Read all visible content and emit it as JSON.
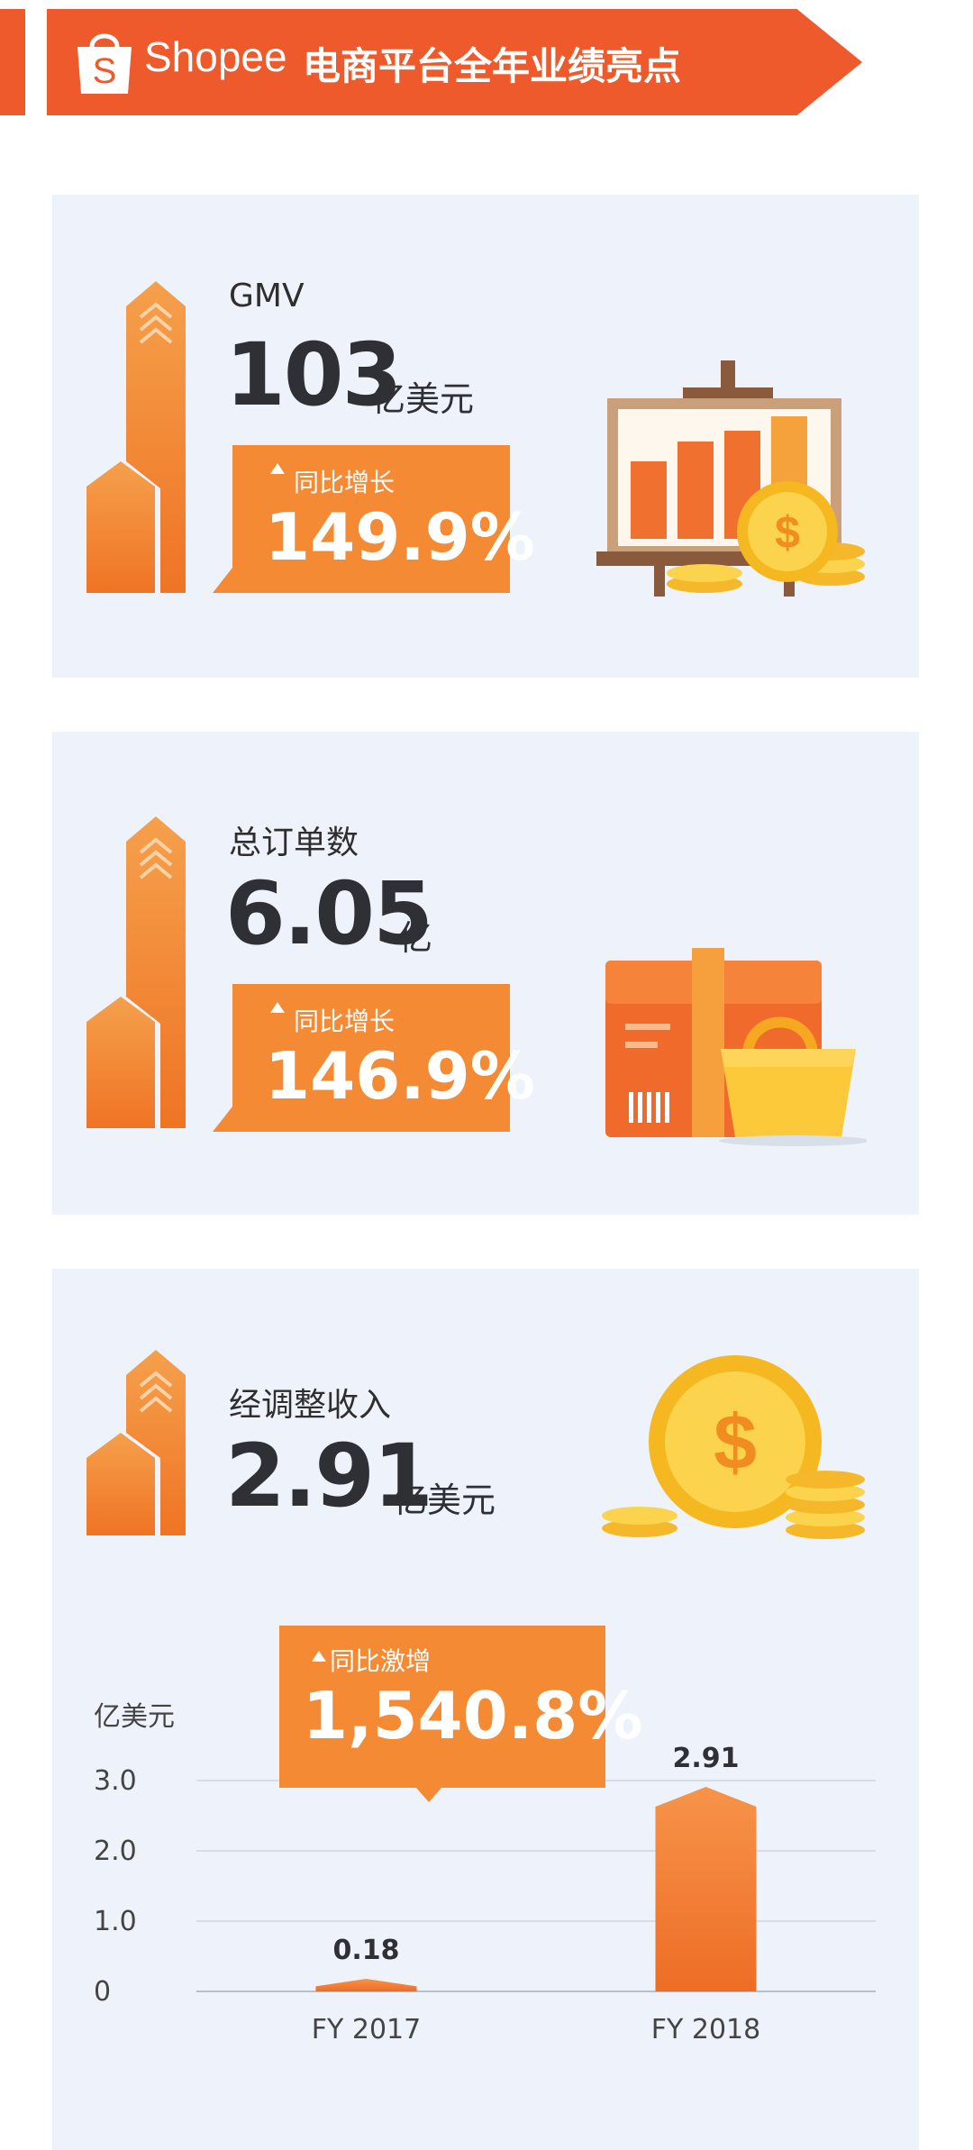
{
  "header": {
    "brand": "Shopee",
    "title": "电商平台全年业绩亮点",
    "bag_letter": "S"
  },
  "cards": [
    {
      "label": "GMV",
      "value": "103",
      "unit": "亿美元",
      "badge_label": "同比增长",
      "badge_value": "149.9%",
      "illustration": "chart-easel-with-coins-icon"
    },
    {
      "label": "总订单数",
      "value": "6.05",
      "unit": "亿",
      "badge_label": "同比增长",
      "badge_value": "146.9%",
      "illustration": "box-and-shopping-bag-icon"
    },
    {
      "label": "经调整收入",
      "value": "2.91",
      "unit": "亿美元",
      "badge_label": "同比激增",
      "badge_value": "1,540.8%",
      "illustration": "gold-coins-icon"
    }
  ],
  "colors": {
    "brand": "#ee5a2c",
    "accent": "#f58a35",
    "card_bg": "#eef3fb",
    "value_text": "#2e3035",
    "coin": "#f7b824"
  },
  "chart_data": {
    "type": "bar",
    "ylabel": "亿美元",
    "categories": [
      "FY 2017",
      "FY 2018"
    ],
    "values": [
      0.18,
      2.91
    ],
    "data_labels": [
      "0.18",
      "2.91"
    ],
    "yticks": [
      "3.0",
      "2.0",
      "1.0",
      "0"
    ],
    "ylim": [
      0,
      3.0
    ],
    "grid": true,
    "annotation": {
      "label": "同比激增",
      "value": "1,540.8%"
    }
  }
}
